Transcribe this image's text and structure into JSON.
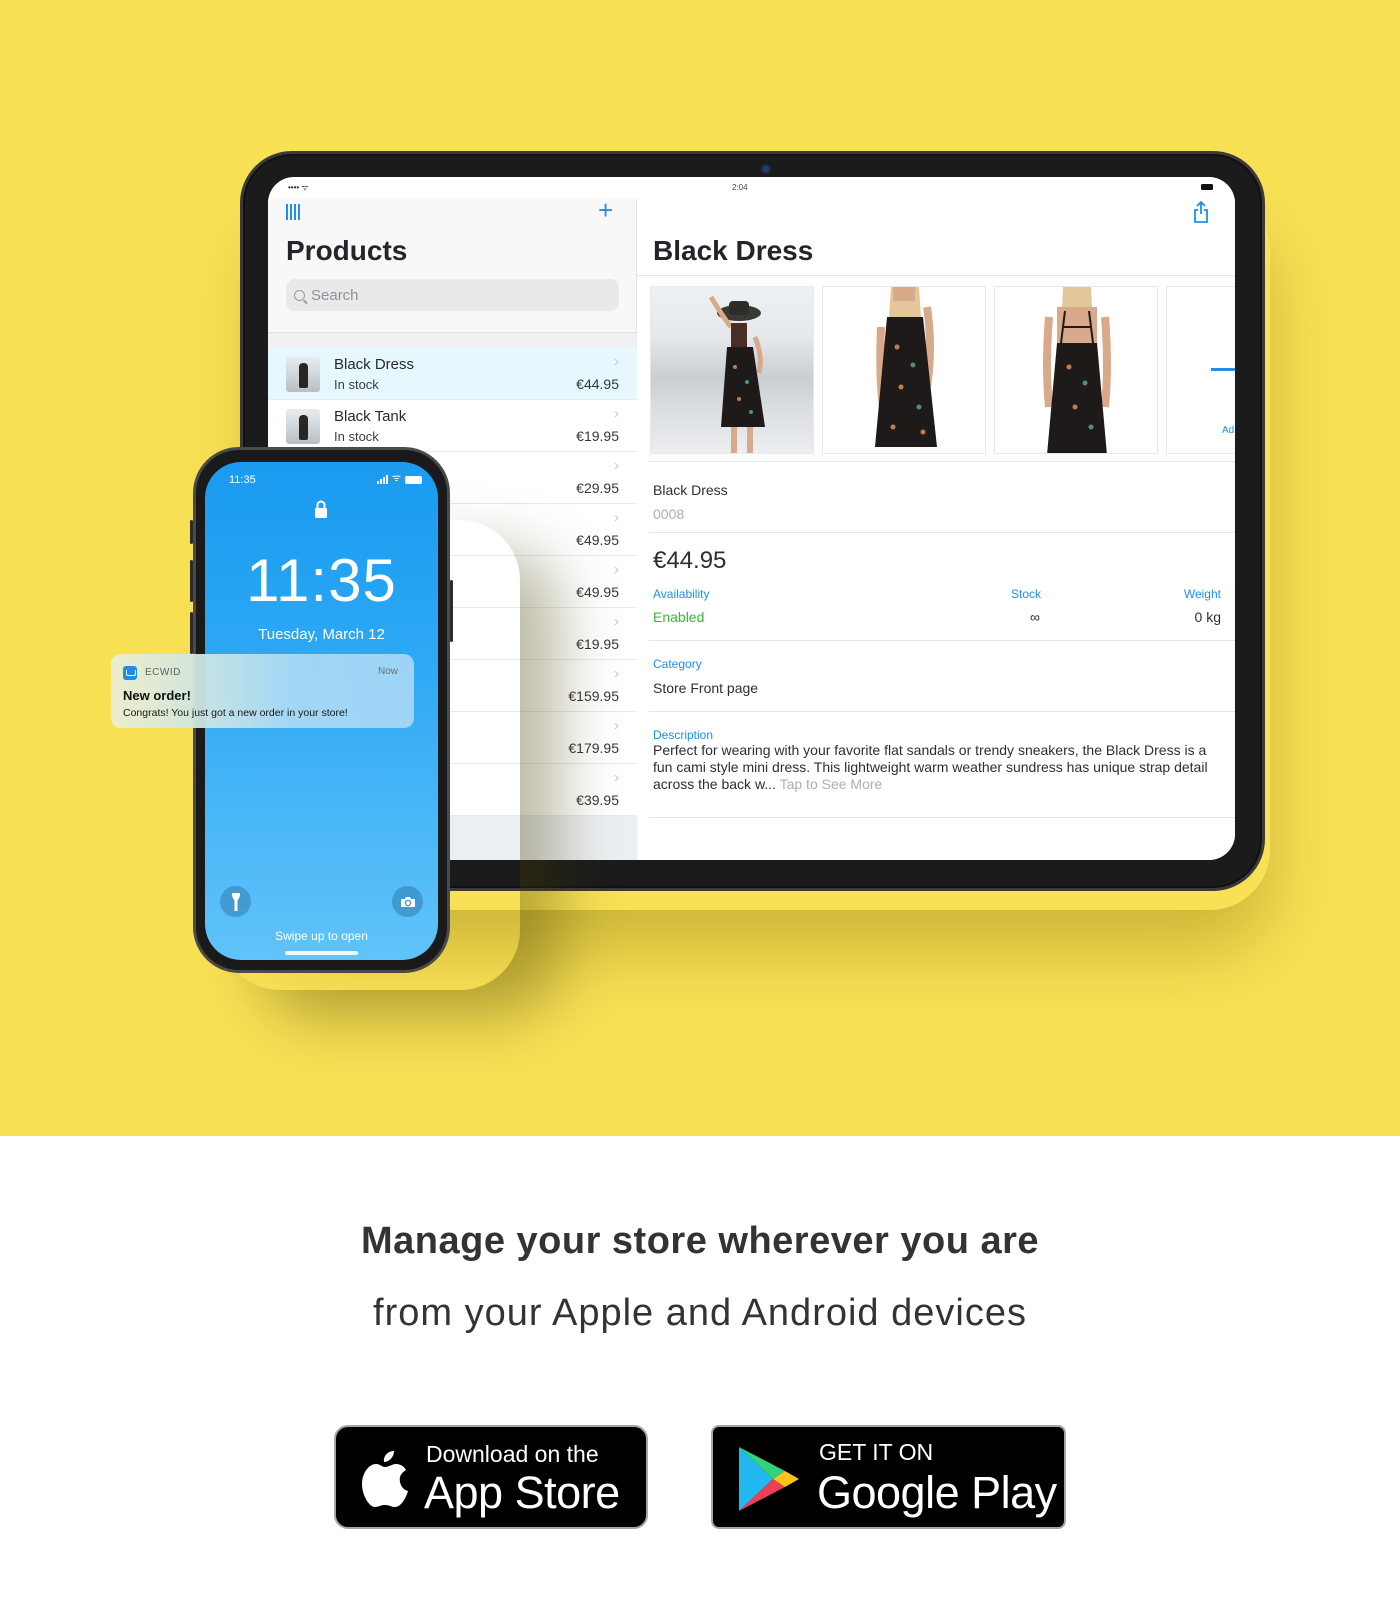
{
  "colors": {
    "hero_background": "#f9e155",
    "accent_blue": "#1e90e8",
    "enabled_green": "#3cb43c",
    "selected_row": "#e6f7fd"
  },
  "tablet": {
    "status_bar": {
      "signal": "•••• ᯤ",
      "time": "2:04"
    },
    "sidebar": {
      "barcode_icon": "barcode-icon",
      "add_icon": "+",
      "title": "Products",
      "search_placeholder": "Search",
      "products": [
        {
          "name": "Black Dress",
          "stock": "In stock",
          "price": "€44.95",
          "selected": true
        },
        {
          "name": "Black Tank",
          "stock": "In stock",
          "price": "€19.95",
          "selected": false
        },
        {
          "name": "",
          "stock": "",
          "price": "€29.95",
          "selected": false
        },
        {
          "name": "",
          "stock": "",
          "price": "€49.95",
          "selected": false
        },
        {
          "name": "",
          "stock": "",
          "price": "€49.95",
          "selected": false
        },
        {
          "name": "",
          "stock": "",
          "price": "€19.95",
          "selected": false
        },
        {
          "name": "",
          "stock": "",
          "price": "€159.95",
          "selected": false
        },
        {
          "name": "",
          "stock": "",
          "price": "€179.95",
          "selected": false
        },
        {
          "name": "",
          "stock": "",
          "price": "€39.95",
          "selected": false
        }
      ],
      "chevron": "›"
    },
    "detail": {
      "share_icon": "share-icon",
      "title": "Black Dress",
      "photos": [
        "beach-dress-photo",
        "front-dress-photo",
        "back-dress-photo"
      ],
      "add_photo_label": "Ad",
      "name": "Black Dress",
      "sku": "0008",
      "price": "€44.95",
      "availability_label": "Availability",
      "availability_value": "Enabled",
      "stock_label": "Stock",
      "stock_value": "∞",
      "weight_label": "Weight",
      "weight_value": "0 kg",
      "category_label": "Category",
      "category_value": "Store Front page",
      "description_label": "Description",
      "description_text": "Perfect for wearing with your favorite flat sandals or trendy sneakers, the Black Dress is a fun cami style mini dress. This lightweight warm weather sundress has unique strap detail across the back w... ",
      "see_more": "Tap to See More"
    }
  },
  "phone": {
    "status_time": "11:35",
    "lock_time": "11:35",
    "date": "Tuesday, March 12",
    "swipe_text": "Swipe up to open",
    "flashlight_icon": "flashlight-icon",
    "camera_icon": "camera-icon",
    "notification": {
      "app": "ECWID",
      "time": "Now",
      "title": "New order!",
      "body": "Congrats! You just got a new order in your store!"
    }
  },
  "marketing": {
    "headline": "Manage your store wherever you are",
    "subline": "from your Apple and Android devices",
    "app_store": {
      "small": "Download on the",
      "big": "App Store"
    },
    "google_play": {
      "small": "GET IT ON",
      "big": "Google Play"
    }
  }
}
